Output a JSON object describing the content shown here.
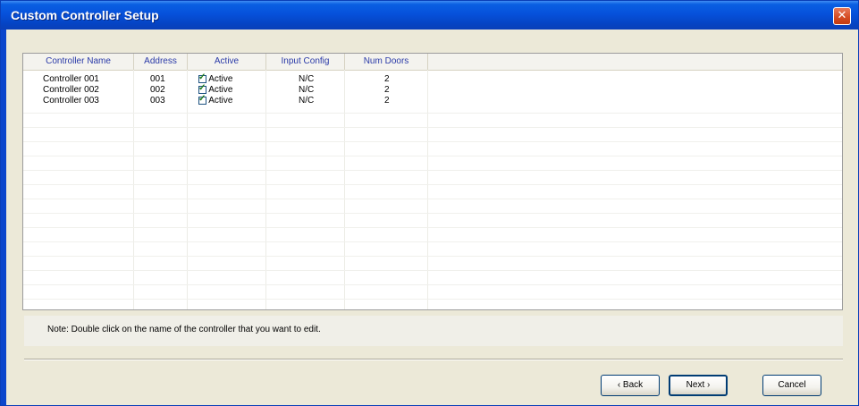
{
  "window": {
    "title": "Custom Controller Setup",
    "close_glyph": "✕"
  },
  "table": {
    "columns": [
      "Controller Name",
      "Address",
      "Active",
      "Input Config",
      "Num Doors"
    ],
    "rows": [
      {
        "name": "Controller 001",
        "address": "001",
        "active": true,
        "active_label": "Active",
        "input_config": "N/C",
        "num_doors": "2"
      },
      {
        "name": "Controller 002",
        "address": "002",
        "active": true,
        "active_label": "Active",
        "input_config": "N/C",
        "num_doors": "2"
      },
      {
        "name": "Controller 003",
        "address": "003",
        "active": true,
        "active_label": "Active",
        "input_config": "N/C",
        "num_doors": "2"
      }
    ]
  },
  "note": "Note: Double click on the name of the controller that you want to edit.",
  "buttons": {
    "back": "‹ Back",
    "next": "Next ›",
    "cancel": "Cancel"
  },
  "colors": {
    "title_bar": "#0651db",
    "close": "#d44b22",
    "header_text": "#2a3aa8",
    "dialog": "#ece9d8"
  }
}
